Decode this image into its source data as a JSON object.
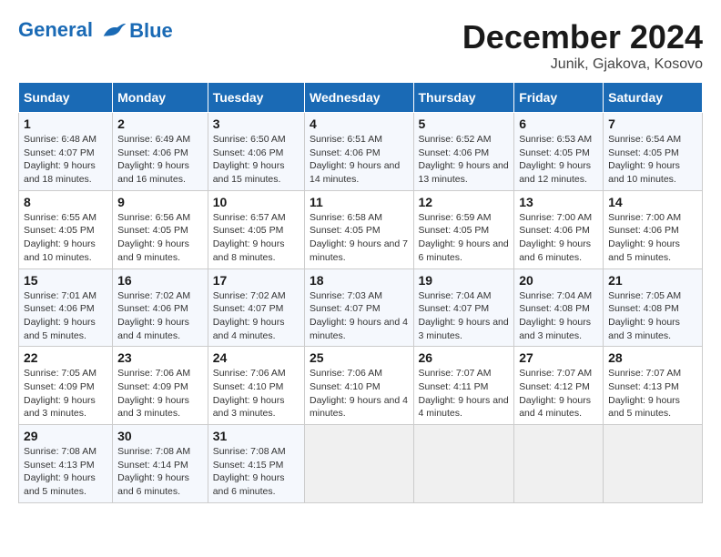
{
  "header": {
    "logo_line1": "General",
    "logo_line2": "Blue",
    "month_title": "December 2024",
    "location": "Junik, Gjakova, Kosovo"
  },
  "days_of_week": [
    "Sunday",
    "Monday",
    "Tuesday",
    "Wednesday",
    "Thursday",
    "Friday",
    "Saturday"
  ],
  "weeks": [
    [
      {
        "day": "1",
        "sunrise": "6:48 AM",
        "sunset": "4:07 PM",
        "daylight": "9 hours and 18 minutes."
      },
      {
        "day": "2",
        "sunrise": "6:49 AM",
        "sunset": "4:06 PM",
        "daylight": "9 hours and 16 minutes."
      },
      {
        "day": "3",
        "sunrise": "6:50 AM",
        "sunset": "4:06 PM",
        "daylight": "9 hours and 15 minutes."
      },
      {
        "day": "4",
        "sunrise": "6:51 AM",
        "sunset": "4:06 PM",
        "daylight": "9 hours and 14 minutes."
      },
      {
        "day": "5",
        "sunrise": "6:52 AM",
        "sunset": "4:06 PM",
        "daylight": "9 hours and 13 minutes."
      },
      {
        "day": "6",
        "sunrise": "6:53 AM",
        "sunset": "4:05 PM",
        "daylight": "9 hours and 12 minutes."
      },
      {
        "day": "7",
        "sunrise": "6:54 AM",
        "sunset": "4:05 PM",
        "daylight": "9 hours and 10 minutes."
      }
    ],
    [
      {
        "day": "8",
        "sunrise": "6:55 AM",
        "sunset": "4:05 PM",
        "daylight": "9 hours and 10 minutes."
      },
      {
        "day": "9",
        "sunrise": "6:56 AM",
        "sunset": "4:05 PM",
        "daylight": "9 hours and 9 minutes."
      },
      {
        "day": "10",
        "sunrise": "6:57 AM",
        "sunset": "4:05 PM",
        "daylight": "9 hours and 8 minutes."
      },
      {
        "day": "11",
        "sunrise": "6:58 AM",
        "sunset": "4:05 PM",
        "daylight": "9 hours and 7 minutes."
      },
      {
        "day": "12",
        "sunrise": "6:59 AM",
        "sunset": "4:05 PM",
        "daylight": "9 hours and 6 minutes."
      },
      {
        "day": "13",
        "sunrise": "7:00 AM",
        "sunset": "4:06 PM",
        "daylight": "9 hours and 6 minutes."
      },
      {
        "day": "14",
        "sunrise": "7:00 AM",
        "sunset": "4:06 PM",
        "daylight": "9 hours and 5 minutes."
      }
    ],
    [
      {
        "day": "15",
        "sunrise": "7:01 AM",
        "sunset": "4:06 PM",
        "daylight": "9 hours and 5 minutes."
      },
      {
        "day": "16",
        "sunrise": "7:02 AM",
        "sunset": "4:06 PM",
        "daylight": "9 hours and 4 minutes."
      },
      {
        "day": "17",
        "sunrise": "7:02 AM",
        "sunset": "4:07 PM",
        "daylight": "9 hours and 4 minutes."
      },
      {
        "day": "18",
        "sunrise": "7:03 AM",
        "sunset": "4:07 PM",
        "daylight": "9 hours and 4 minutes."
      },
      {
        "day": "19",
        "sunrise": "7:04 AM",
        "sunset": "4:07 PM",
        "daylight": "9 hours and 3 minutes."
      },
      {
        "day": "20",
        "sunrise": "7:04 AM",
        "sunset": "4:08 PM",
        "daylight": "9 hours and 3 minutes."
      },
      {
        "day": "21",
        "sunrise": "7:05 AM",
        "sunset": "4:08 PM",
        "daylight": "9 hours and 3 minutes."
      }
    ],
    [
      {
        "day": "22",
        "sunrise": "7:05 AM",
        "sunset": "4:09 PM",
        "daylight": "9 hours and 3 minutes."
      },
      {
        "day": "23",
        "sunrise": "7:06 AM",
        "sunset": "4:09 PM",
        "daylight": "9 hours and 3 minutes."
      },
      {
        "day": "24",
        "sunrise": "7:06 AM",
        "sunset": "4:10 PM",
        "daylight": "9 hours and 3 minutes."
      },
      {
        "day": "25",
        "sunrise": "7:06 AM",
        "sunset": "4:10 PM",
        "daylight": "9 hours and 4 minutes."
      },
      {
        "day": "26",
        "sunrise": "7:07 AM",
        "sunset": "4:11 PM",
        "daylight": "9 hours and 4 minutes."
      },
      {
        "day": "27",
        "sunrise": "7:07 AM",
        "sunset": "4:12 PM",
        "daylight": "9 hours and 4 minutes."
      },
      {
        "day": "28",
        "sunrise": "7:07 AM",
        "sunset": "4:13 PM",
        "daylight": "9 hours and 5 minutes."
      }
    ],
    [
      {
        "day": "29",
        "sunrise": "7:08 AM",
        "sunset": "4:13 PM",
        "daylight": "9 hours and 5 minutes."
      },
      {
        "day": "30",
        "sunrise": "7:08 AM",
        "sunset": "4:14 PM",
        "daylight": "9 hours and 6 minutes."
      },
      {
        "day": "31",
        "sunrise": "7:08 AM",
        "sunset": "4:15 PM",
        "daylight": "9 hours and 6 minutes."
      },
      null,
      null,
      null,
      null
    ]
  ]
}
